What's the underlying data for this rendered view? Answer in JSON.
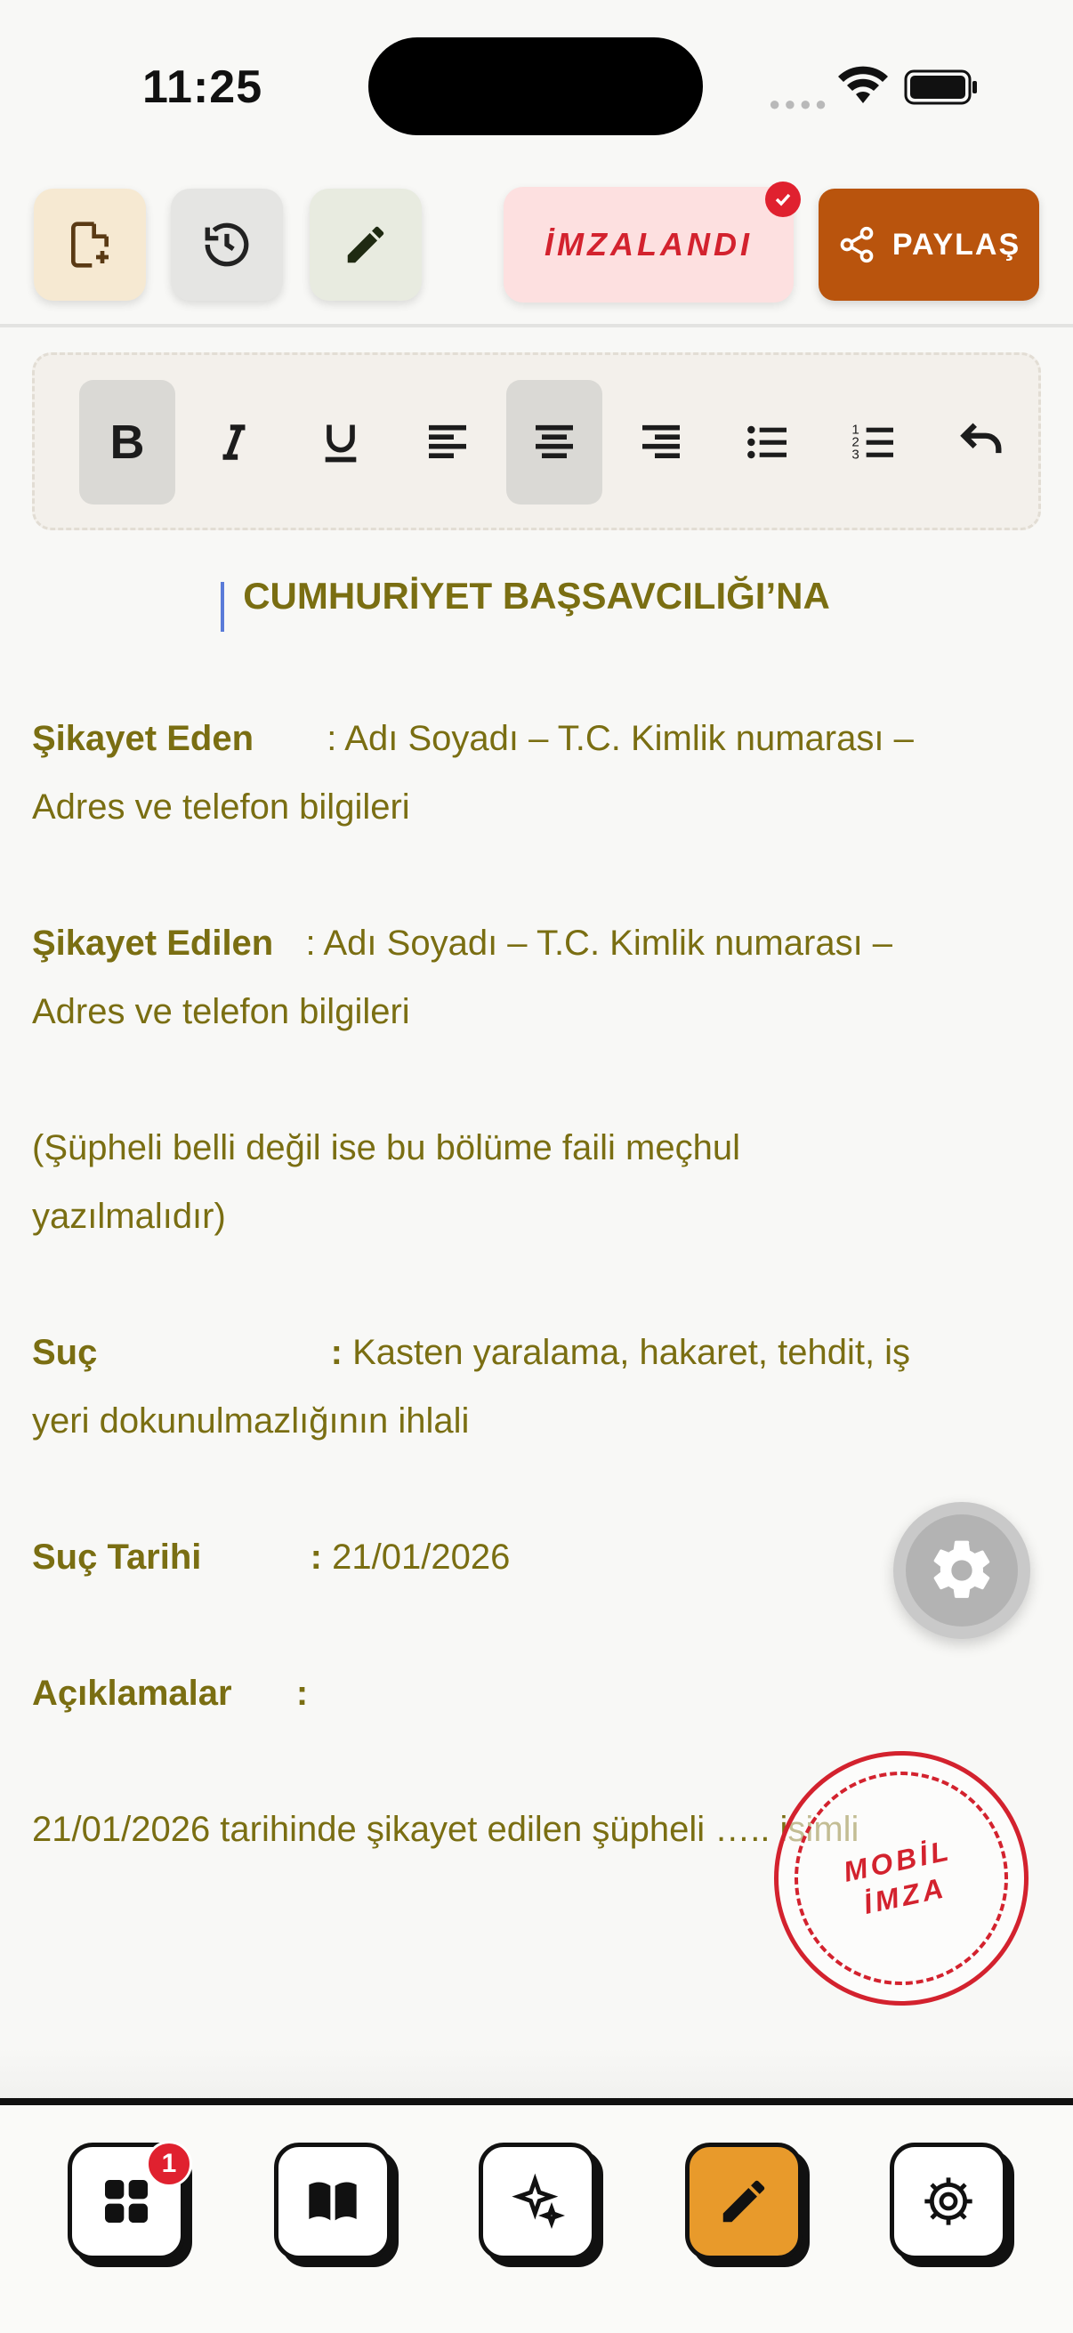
{
  "status_bar": {
    "time": "11:25"
  },
  "toolbar": {
    "signed_label": "İMZALANDI",
    "share_label": "PAYLAŞ"
  },
  "document": {
    "title": "CUMHURİYET BAŞSAVCILIĞI’NA",
    "complainant_label": "Şikayet Eden",
    "complainant_value": ": Adı Soyadı – T.C. Kimlik numarası –",
    "complainant_cont": "Adres ve telefon bilgileri",
    "respondent_label": "Şikayet Edilen",
    "respondent_value": ": Adı Soyadı – T.C. Kimlik numarası –",
    "respondent_cont": "Adres ve telefon bilgileri",
    "note_line1": "(Şüpheli belli değil ise bu bölüme faili meçhul",
    "note_line2": "yazılmalıdır)",
    "crime_label": "Suç",
    "crime_colon": ":",
    "crime_value": "Kasten yaralama, hakaret, tehdit, iş",
    "crime_cont": "yeri dokunulmazlığının ihlali",
    "date_label": "Suç Tarihi",
    "date_colon": ":",
    "date_value": "21/01/2026",
    "desc_label": "Açıklamalar",
    "desc_colon": ":",
    "body_line": "21/01/2026 tarihinde şikayet edilen şüpheli ….. isimli"
  },
  "stamp": {
    "line1": "MOBİL",
    "line2": "İMZA"
  },
  "bottom_nav": {
    "badge_count": "1"
  },
  "colors": {
    "text": "#7a6e12",
    "accent": "#b9540d",
    "signed": "#d3222e",
    "active_nav": "#e89a2b"
  }
}
